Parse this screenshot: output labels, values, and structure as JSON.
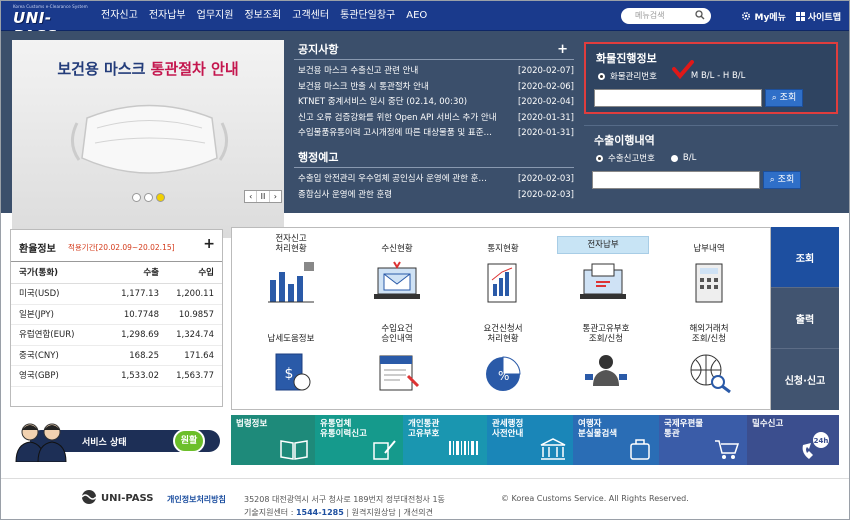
{
  "header": {
    "logo_sub": "Korea Customs e-Clearance System",
    "logo_text": "UNI-PASS",
    "menu": [
      "전자신고",
      "전자납부",
      "업무지원",
      "정보조회",
      "고객센터",
      "통관단일창구",
      "AEO"
    ],
    "search_placeholder": "메뉴검색",
    "my_menu": "My메뉴",
    "sitemap": "사이트맵"
  },
  "banner": {
    "title_a": "보건용 마스크 ",
    "title_b": "통관절차 안내",
    "ctrl": [
      "‹",
      "II",
      "›"
    ]
  },
  "notices": {
    "title": "공지사항",
    "items": [
      {
        "t": "보건용 마스크 수출신고 관련 안내",
        "d": "[2020-02-07]"
      },
      {
        "t": "보건용 마스크 반출 시 통관절차 안내",
        "d": "[2020-02-06]"
      },
      {
        "t": "KTNET 중계서비스 일시 중단 (02.14, 00:30)",
        "d": "[2020-02-04]"
      },
      {
        "t": "신고 오류 검증강화를 위한 Open API 서비스 추가 안내",
        "d": "[2020-01-31]"
      },
      {
        "t": "수입물품유통이력 고시개정에 따른 대상물품 및 표준…",
        "d": "[2020-01-31]"
      }
    ]
  },
  "admin_notice": {
    "title": "행정예고",
    "items": [
      {
        "t": "수출입 안전관리 우수업체 공인심사 운영에 관한 훈…",
        "d": "[2020-02-03]"
      },
      {
        "t": "종합심사 운영에 관한 훈령",
        "d": "[2020-02-03]"
      }
    ]
  },
  "cargo": {
    "title": "화물진행정보",
    "opt1": "화물관리번호",
    "opt2": "M B/L - H B/L",
    "btn": "조회"
  },
  "export": {
    "title": "수출이행내역",
    "opt1": "수출신고번호",
    "opt2": "B/L",
    "btn": "조회"
  },
  "rates": {
    "title": "환율정보",
    "period": "적용기간[20.02.09~20.02.15]",
    "head": [
      "국가(통화)",
      "수출",
      "수입"
    ],
    "rows": [
      [
        "미국(USD)",
        "1,177.13",
        "1,200.11"
      ],
      [
        "일본(JPY)",
        "10.7748",
        "10.9857"
      ],
      [
        "유럽연합(EUR)",
        "1,298.69",
        "1,324.74"
      ],
      [
        "중국(CNY)",
        "168.25",
        "171.64"
      ],
      [
        "영국(GBP)",
        "1,533.02",
        "1,563.77"
      ]
    ]
  },
  "service": {
    "label": "서비스 상태",
    "status": "원활"
  },
  "grid": [
    {
      "l1": "전자신고",
      "l2": "처리현황"
    },
    {
      "l1": "",
      "l2": "수신현황"
    },
    {
      "l1": "",
      "l2": "통지현황"
    },
    {
      "l1": "",
      "l2": "전자납부"
    },
    {
      "l1": "",
      "l2": "납부내역"
    },
    {
      "l1": "",
      "l2": "납세도움정보"
    },
    {
      "l1": "수입요건",
      "l2": "승인내역"
    },
    {
      "l1": "요건신청서",
      "l2": "처리현황"
    },
    {
      "l1": "통관고유부호",
      "l2": "조회/신청"
    },
    {
      "l1": "해외거래처",
      "l2": "조회/신청"
    }
  ],
  "tabs": [
    "조회",
    "출력",
    "신청·신고"
  ],
  "quick": [
    {
      "l1": "법령정보",
      "l2": "",
      "color": "#1e8a7a"
    },
    {
      "l1": "유통업체",
      "l2": "유통이력신고",
      "color": "#159a8c"
    },
    {
      "l1": "개인통관",
      "l2": "고유부호",
      "color": "#1a96b0"
    },
    {
      "l1": "관세행정",
      "l2": "사전안내",
      "color": "#1a86b8"
    },
    {
      "l1": "여행자",
      "l2": "분실물검색",
      "color": "#2a6db5"
    },
    {
      "l1": "국제우편물",
      "l2": "통관",
      "color": "#3a5ca8"
    },
    {
      "l1": "밀수신고",
      "l2": "",
      "color": "#3b4e8e"
    }
  ],
  "footer": {
    "brand": "UNI-PASS",
    "privacy": "개인정보처리방침",
    "address": "35208 대전광역시 서구 청사로 189번지 정부대전청사 1동",
    "copyright": "© Korea Customs Service. All Rights Reserved.",
    "tech_label": "기술지원센터 : ",
    "tech_phone": "1544-1285",
    "remote": " | 원격지원상담 | 개선의견"
  }
}
